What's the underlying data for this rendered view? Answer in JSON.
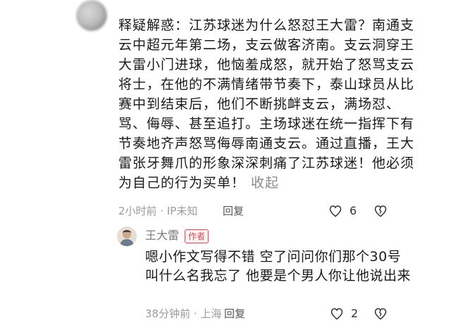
{
  "comment": {
    "text": "释疑解惑：江苏球迷为什么怒怼王大雷？南通支云中超元年第二场，支云做客济南。支云洞穿王大雷小门进球，他恼羞成怒，就开始了怒骂支云将士，在他的不满情绪带节奏下，泰山球员从比赛中到结束后，他们不断挑衅支云，满场怼、骂、侮辱、甚至追打。主场球迷在统一指挥下有节奏地齐声怒骂侮辱南通支云。通过直播，王大雷张牙舞爪的形象深深刺痛了江苏球迷！他必须为自己的行为买单！",
    "collapse_label": "收起",
    "time_location": "2小时前 · IP未知",
    "reply_label": "回复",
    "like_count": "6",
    "like_icon": "heart-outline-icon",
    "dislike_icon": "broken-heart-icon"
  },
  "reply": {
    "author_name": "王大雷",
    "author_badge": "作者",
    "text": "嗯小作文写得不错 空了问问你们那个30号叫什么名我忘了 他要是个男人你让他说出来",
    "time_location": "38分钟前 · 上海",
    "reply_label": "回复",
    "like_count": "2",
    "like_icon": "heart-outline-icon",
    "dislike_icon": "broken-heart-icon"
  },
  "colors": {
    "badge": "#e8454f",
    "meta_text": "#9b9b9b"
  }
}
